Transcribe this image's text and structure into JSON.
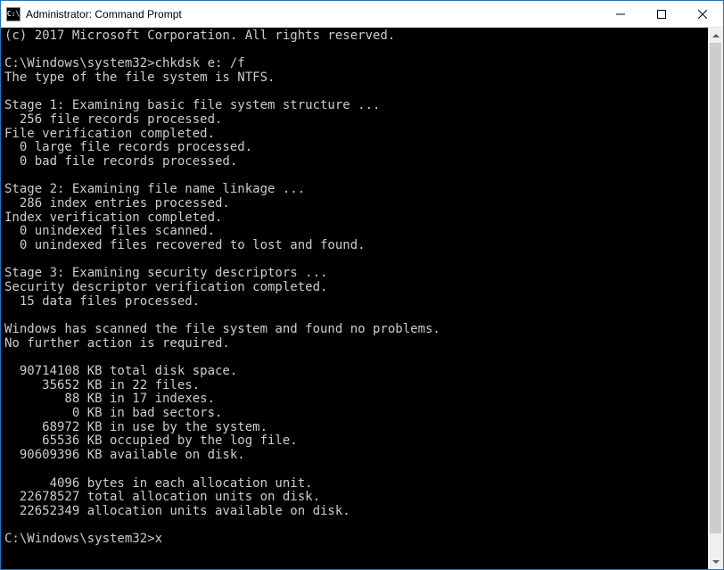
{
  "window": {
    "title": "Administrator: Command Prompt",
    "app_icon_label": "C:\\"
  },
  "terminal": {
    "lines": [
      "(c) 2017 Microsoft Corporation. All rights reserved.",
      "",
      "C:\\Windows\\system32>chkdsk e: /f",
      "The type of the file system is NTFS.",
      "",
      "Stage 1: Examining basic file system structure ...",
      "  256 file records processed.",
      "File verification completed.",
      "  0 large file records processed.",
      "  0 bad file records processed.",
      "",
      "Stage 2: Examining file name linkage ...",
      "  286 index entries processed.",
      "Index verification completed.",
      "  0 unindexed files scanned.",
      "  0 unindexed files recovered to lost and found.",
      "",
      "Stage 3: Examining security descriptors ...",
      "Security descriptor verification completed.",
      "  15 data files processed.",
      "",
      "Windows has scanned the file system and found no problems.",
      "No further action is required.",
      "",
      "  90714108 KB total disk space.",
      "     35652 KB in 22 files.",
      "        88 KB in 17 indexes.",
      "         0 KB in bad sectors.",
      "     68972 KB in use by the system.",
      "     65536 KB occupied by the log file.",
      "  90609396 KB available on disk.",
      "",
      "      4096 bytes in each allocation unit.",
      "  22678527 total allocation units on disk.",
      "  22652349 allocation units available on disk.",
      "",
      "C:\\Windows\\system32>x"
    ]
  }
}
